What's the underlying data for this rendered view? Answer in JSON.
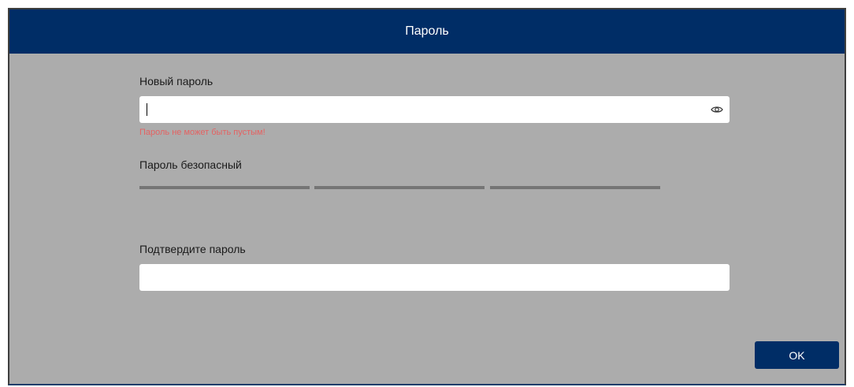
{
  "dialog": {
    "title": "Пароль"
  },
  "new_password": {
    "label": "Новый пароль",
    "value": "",
    "error": "Пароль не может быть пустым!",
    "visibility_icon": "eye-icon"
  },
  "strength": {
    "label": "Пароль безопасный",
    "segments": 3,
    "filled_segments": 0
  },
  "confirm_password": {
    "label": "Подтвердите пароль",
    "value": ""
  },
  "footer": {
    "ok_label": "OK"
  },
  "colors": {
    "titlebar": "#002d66",
    "background": "#acacac",
    "error": "#e46262",
    "strength_empty": "#757575"
  }
}
